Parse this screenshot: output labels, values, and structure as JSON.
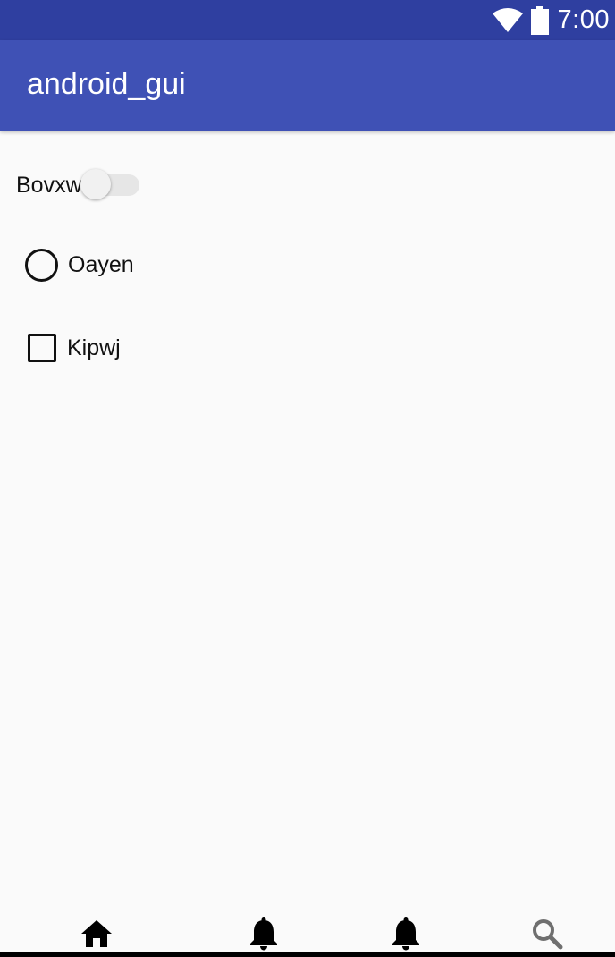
{
  "status_bar": {
    "time": "7:00",
    "background_color": "#2f3fa0",
    "icons": [
      "wifi-icon",
      "battery-icon"
    ]
  },
  "app_bar": {
    "title": "android_gui",
    "background_color": "#3f51b5"
  },
  "content": {
    "switch": {
      "label": "Bovxw",
      "checked": false
    },
    "radio": {
      "label": "Oayen",
      "checked": false
    },
    "checkbox": {
      "label": "Kipwj",
      "checked": false
    }
  },
  "bottom_nav": {
    "items": [
      {
        "icon": "home-icon",
        "active": true
      },
      {
        "icon": "bell-icon",
        "active": false
      },
      {
        "icon": "bell-icon",
        "active": false
      },
      {
        "icon": "search-icon",
        "active": false
      }
    ]
  }
}
